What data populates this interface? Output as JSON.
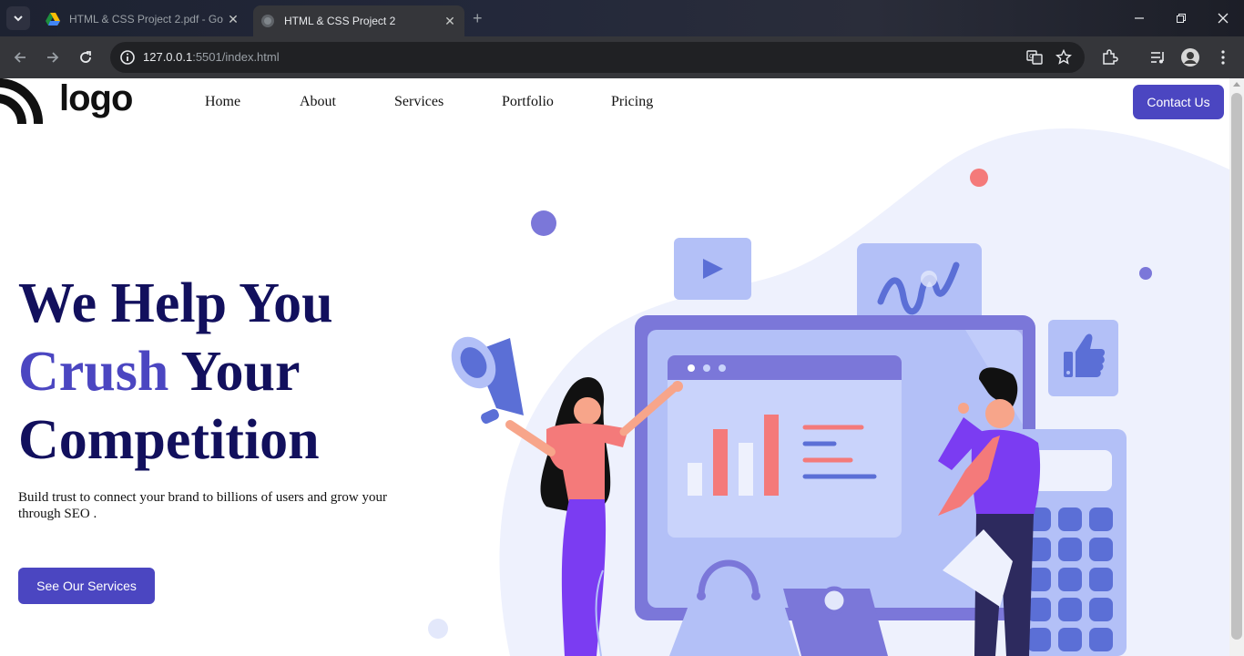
{
  "browser": {
    "tabs": [
      {
        "title": "HTML & CSS Project 2.pdf - Go",
        "active": false
      },
      {
        "title": "HTML & CSS Project 2",
        "active": true
      }
    ],
    "url_host": "127.0.0.1",
    "url_rest": ":5501/index.html"
  },
  "header": {
    "logo_text": "logo",
    "nav": [
      "Home",
      "About",
      "Services",
      "Portfolio",
      "Pricing"
    ],
    "contact_label": "Contact Us"
  },
  "hero": {
    "line1": "We Help You",
    "line2_accent": "Crush",
    "line2_rest": " Your",
    "line3": "Competition",
    "subtitle": "Build trust to connect your brand to billions of users and grow your through SEO .",
    "cta_label": "See Our Services"
  },
  "colors": {
    "primary": "#4b46c1",
    "heading": "#12105d",
    "illustration_light": "#eef1fd",
    "illustration_blue": "#b3c0f7",
    "illustration_purple": "#7b77d9",
    "coral": "#f47a7a"
  }
}
